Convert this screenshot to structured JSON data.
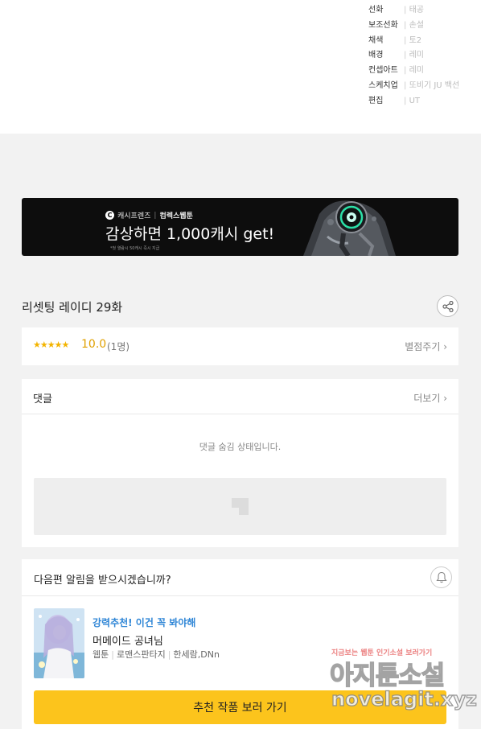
{
  "credits": [
    {
      "role": "선화",
      "name": "태공"
    },
    {
      "role": "보조선화",
      "name": "손설"
    },
    {
      "role": "채색",
      "name": "토2"
    },
    {
      "role": "배경",
      "name": "레미"
    },
    {
      "role": "컨셉아트",
      "name": "레미"
    },
    {
      "role": "스케치업",
      "name": "또비기 JU 백선"
    },
    {
      "role": "편집",
      "name": "UT"
    }
  ],
  "banner": {
    "brand_logo": "C",
    "brand_name": "캐시프렌즈",
    "brand_partner": "컴렉스웹툰",
    "headline": "감상하면 1,000캐시 get!",
    "fine_print": "*첫 열람시 50캐시 즉시 지급"
  },
  "episode": {
    "title": "리셋팅 레이디 29화"
  },
  "rating": {
    "stars": "★★★★★",
    "score": "10.0",
    "count": "(1명)",
    "rate_label": "별점주기 ›"
  },
  "comments": {
    "label": "댓글",
    "more_label": "더보기 ›",
    "hidden_message": "댓글 숨김 상태입니다."
  },
  "notify": {
    "question": "다음편 알림을 받으시겠습니까?"
  },
  "recommend": {
    "tag": "강력추천! 이건 꼭 봐야해",
    "title": "머메이드 공녀님",
    "category": "웹툰",
    "genre": "로맨스판타지",
    "authors": "한세람,DNn",
    "button_label": "추천 작품 보러 가기"
  },
  "watermark": {
    "top": "지금보는 웹툰 인기소설 보러가기",
    "main": "아지툰소설",
    "url": "novelagit.xyz"
  },
  "colors": {
    "accent_yellow": "#fcc41c",
    "star": "#f3b400",
    "tag_blue": "#2f86d6"
  },
  "icons": {
    "share": "share-icon",
    "bell": "bell-icon",
    "placeholder": "image-placeholder-icon"
  }
}
